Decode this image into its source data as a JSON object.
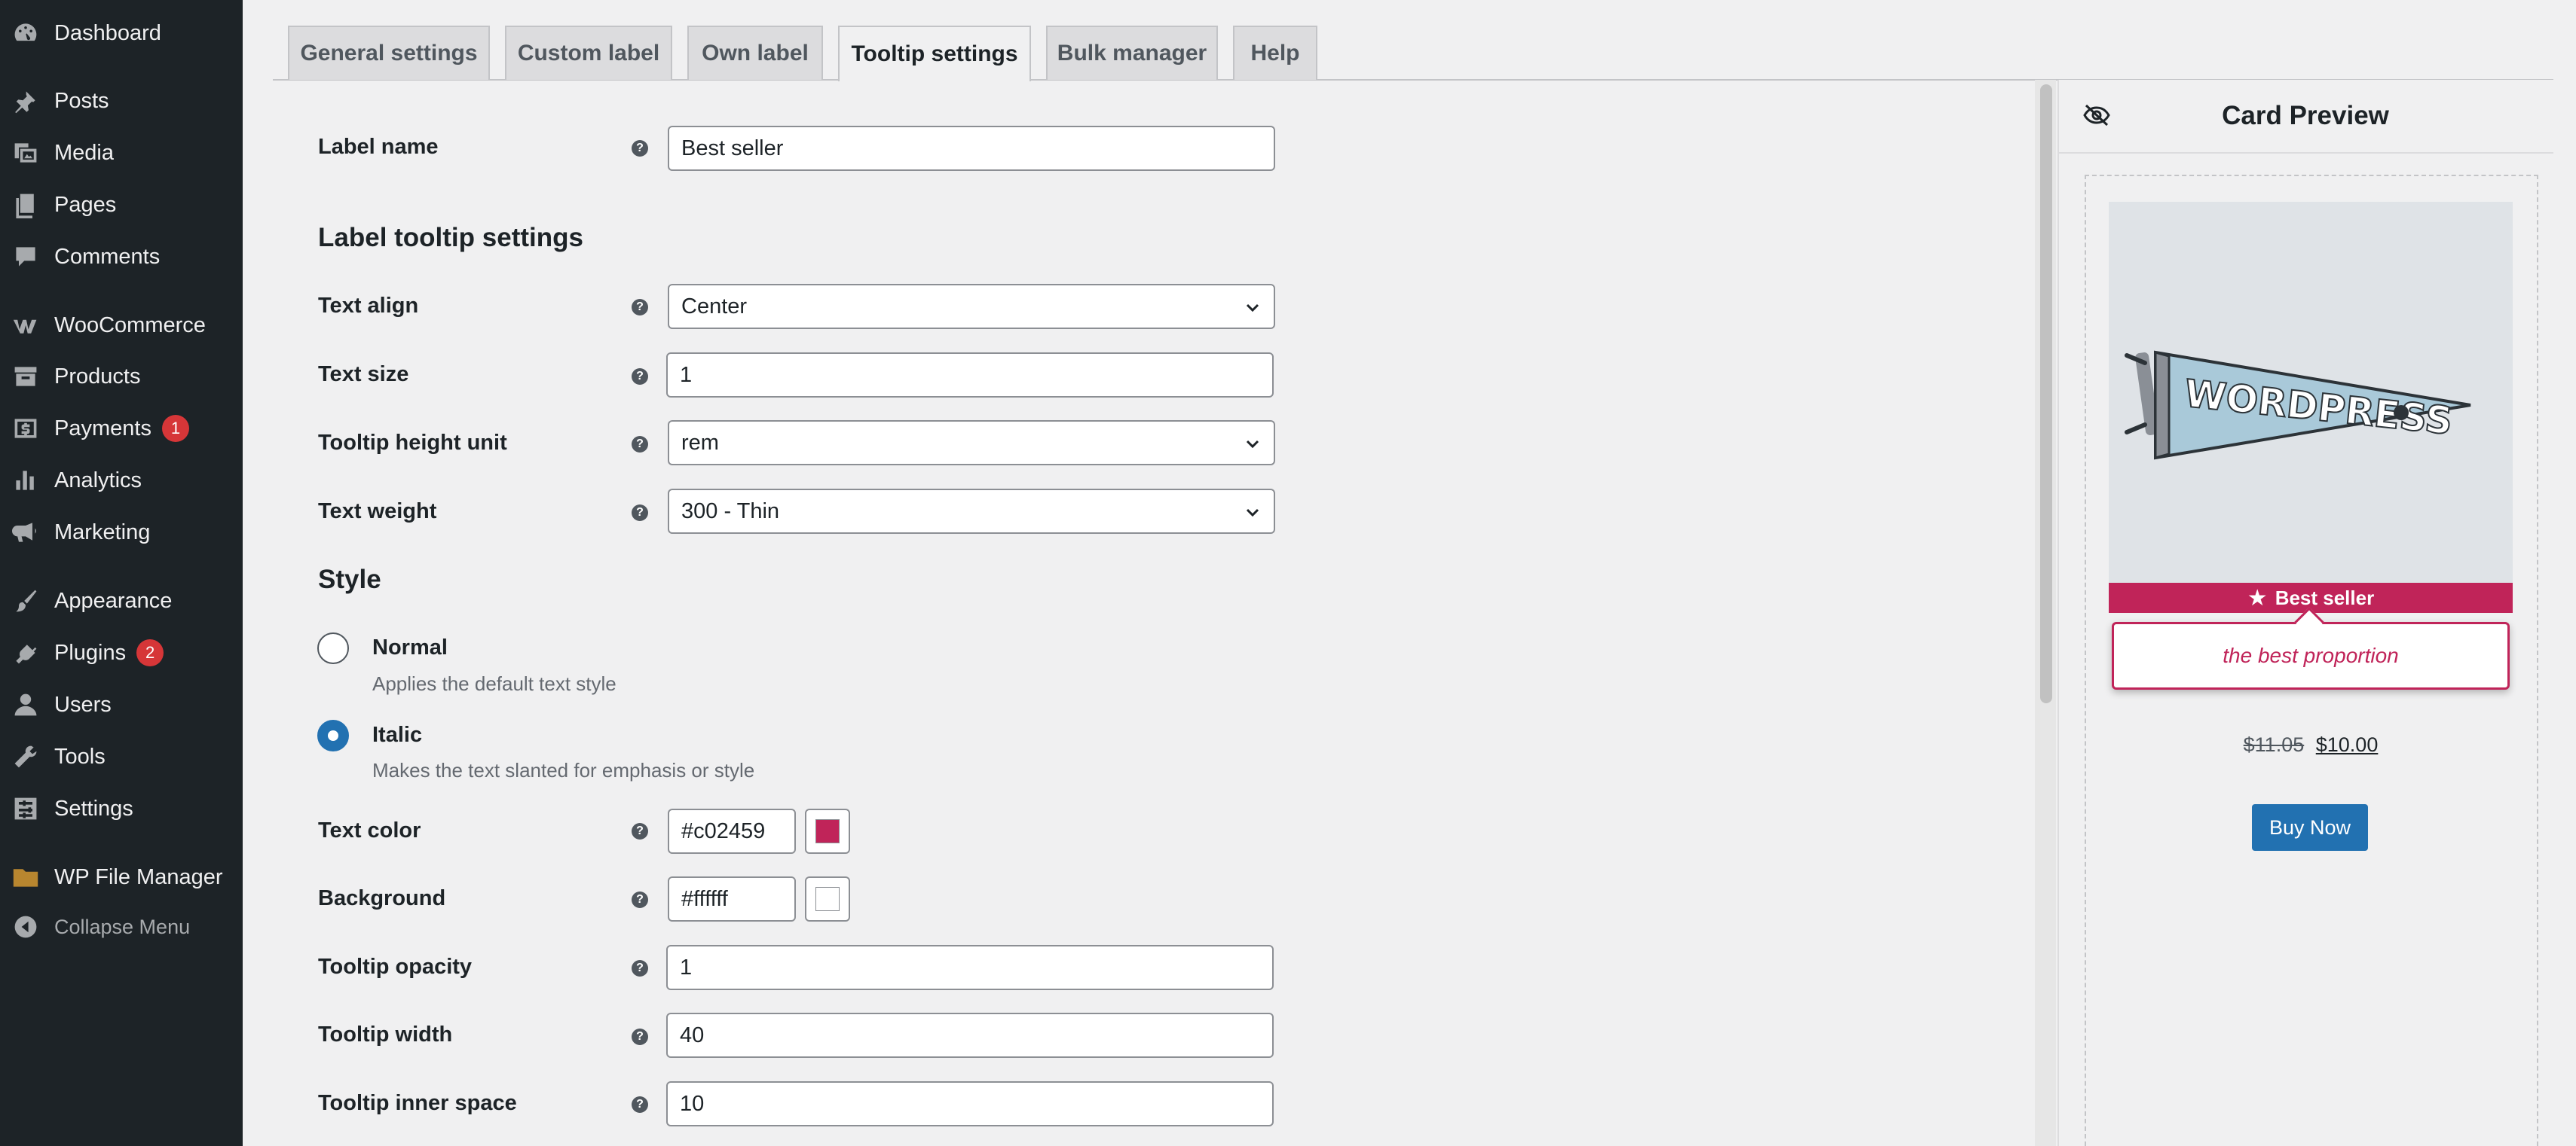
{
  "sidebar": {
    "items": [
      {
        "label": "Dashboard",
        "icon": "dashboard-icon"
      },
      {
        "label": "Posts",
        "icon": "pushpin-icon"
      },
      {
        "label": "Media",
        "icon": "media-icon"
      },
      {
        "label": "Pages",
        "icon": "pages-icon"
      },
      {
        "label": "Comments",
        "icon": "comment-icon"
      },
      {
        "label": "WooCommerce",
        "icon": "woocommerce-icon"
      },
      {
        "label": "Products",
        "icon": "archive-icon"
      },
      {
        "label": "Payments",
        "icon": "dollar-icon",
        "badge": "1"
      },
      {
        "label": "Analytics",
        "icon": "bar-chart-icon"
      },
      {
        "label": "Marketing",
        "icon": "megaphone-icon"
      },
      {
        "label": "Appearance",
        "icon": "paintbrush-icon"
      },
      {
        "label": "Plugins",
        "icon": "plug-icon",
        "badge": "2"
      },
      {
        "label": "Users",
        "icon": "user-icon"
      },
      {
        "label": "Tools",
        "icon": "wrench-icon"
      },
      {
        "label": "Settings",
        "icon": "settings-icon"
      },
      {
        "label": "WP File Manager",
        "icon": "folder-icon"
      }
    ],
    "collapse_label": "Collapse Menu"
  },
  "tabs": [
    {
      "label": "General settings",
      "active": false
    },
    {
      "label": "Custom label",
      "active": false
    },
    {
      "label": "Own label",
      "active": false
    },
    {
      "label": "Tooltip settings",
      "active": true
    },
    {
      "label": "Bulk manager",
      "active": false
    },
    {
      "label": "Help",
      "active": false
    }
  ],
  "form": {
    "label_name": {
      "label": "Label name",
      "value": "Best seller"
    },
    "tooltip_section_title": "Label tooltip settings",
    "text_align": {
      "label": "Text align",
      "value": "Center"
    },
    "text_size": {
      "label": "Text size",
      "value": "1"
    },
    "tooltip_height_unit": {
      "label": "Tooltip height unit",
      "value": "rem"
    },
    "text_weight": {
      "label": "Text weight",
      "value": "300 - Thin"
    },
    "style_title": "Style",
    "style_options": [
      {
        "label": "Normal",
        "description": "Applies the default text style",
        "checked": false
      },
      {
        "label": "Italic",
        "description": "Makes the text slanted for emphasis or style",
        "checked": true
      }
    ],
    "text_color": {
      "label": "Text color",
      "value": "#c02459"
    },
    "background": {
      "label": "Background",
      "value": "#ffffff"
    },
    "tooltip_opacity": {
      "label": "Tooltip opacity",
      "value": "1"
    },
    "tooltip_width": {
      "label": "Tooltip width",
      "value": "40"
    },
    "tooltip_inner_space": {
      "label": "Tooltip inner space",
      "value": "10"
    }
  },
  "preview": {
    "title": "Card Preview",
    "product_image_text": "WORDPRESS",
    "label_text": "Best seller",
    "tooltip_text": "the best proportion",
    "price_old": "$11.05",
    "price_new": "$10.00",
    "buy_button": "Buy Now"
  },
  "colors": {
    "sidebar_bg": "#1d2327",
    "accent": "#2271b1",
    "label_color": "#c02459",
    "badge": "#d63638"
  }
}
